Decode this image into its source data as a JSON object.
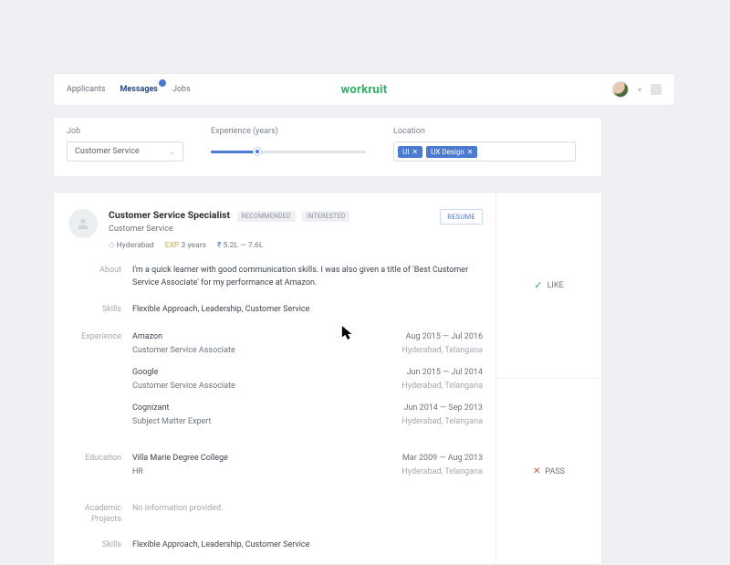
{
  "nav": {
    "items": [
      {
        "label": "Applicants"
      },
      {
        "label": "Messages",
        "active": true,
        "has_badge": true
      },
      {
        "label": "Jobs"
      }
    ]
  },
  "brand": {
    "name": "workruit",
    "accent": "#2eb163"
  },
  "filters": {
    "job_label": "Job",
    "job_value": "Customer Service",
    "exp_label": "Experience (years)",
    "location_label": "Location",
    "location_chips": [
      {
        "label": "UI"
      },
      {
        "label": "UX Design"
      }
    ]
  },
  "profile": {
    "title": "Customer Service Specialist",
    "tags": [
      "RECOMMENDED",
      "INTERESTED"
    ],
    "role": "Customer Service",
    "meta": {
      "location": "Hyderabad",
      "exp_prefix": "EXP",
      "exp_value": "3 years",
      "salary": "5.2L — 7.6L"
    },
    "resume_btn": "RESUME",
    "about_label": "About",
    "about_text": "I'm a quick learner with good communication skills. I was also given a title of 'Best Customer Service Associate' for my performance at Amazon.",
    "skills_label": "Skills",
    "skills_text": "Flexible Approach, Leadership, Customer Service",
    "experience_label": "Experience",
    "experience": [
      {
        "company": "Amazon",
        "role": "Customer Service Associate",
        "dates": "Aug 2015 — Jul 2016",
        "loc": "Hyderabad, Telangana"
      },
      {
        "company": "Google",
        "role": "Customer Service Associate",
        "dates": "Jun 2015 — Jul 2014",
        "loc": "Hyderabad, Telangana"
      },
      {
        "company": "Cognizant",
        "role": "Subject Matter Expert",
        "dates": "Jun 2014 — Sep 2013",
        "loc": "Hyderabad, Telangana"
      }
    ],
    "education_label": "Education",
    "education": [
      {
        "company": "Villa Marie Degree College",
        "role": "HR",
        "dates": "Mar 2009 — Aug 2013",
        "loc": "Hyderabad, Telangana"
      }
    ],
    "academic_label": "Academic Projects",
    "academic_text": "No information provided.",
    "skills2_label": "Skills",
    "skills2_text": "Flexible Approach, Leadership, Customer Service"
  },
  "actions": {
    "like": "LIKE",
    "pass": "PASS"
  }
}
